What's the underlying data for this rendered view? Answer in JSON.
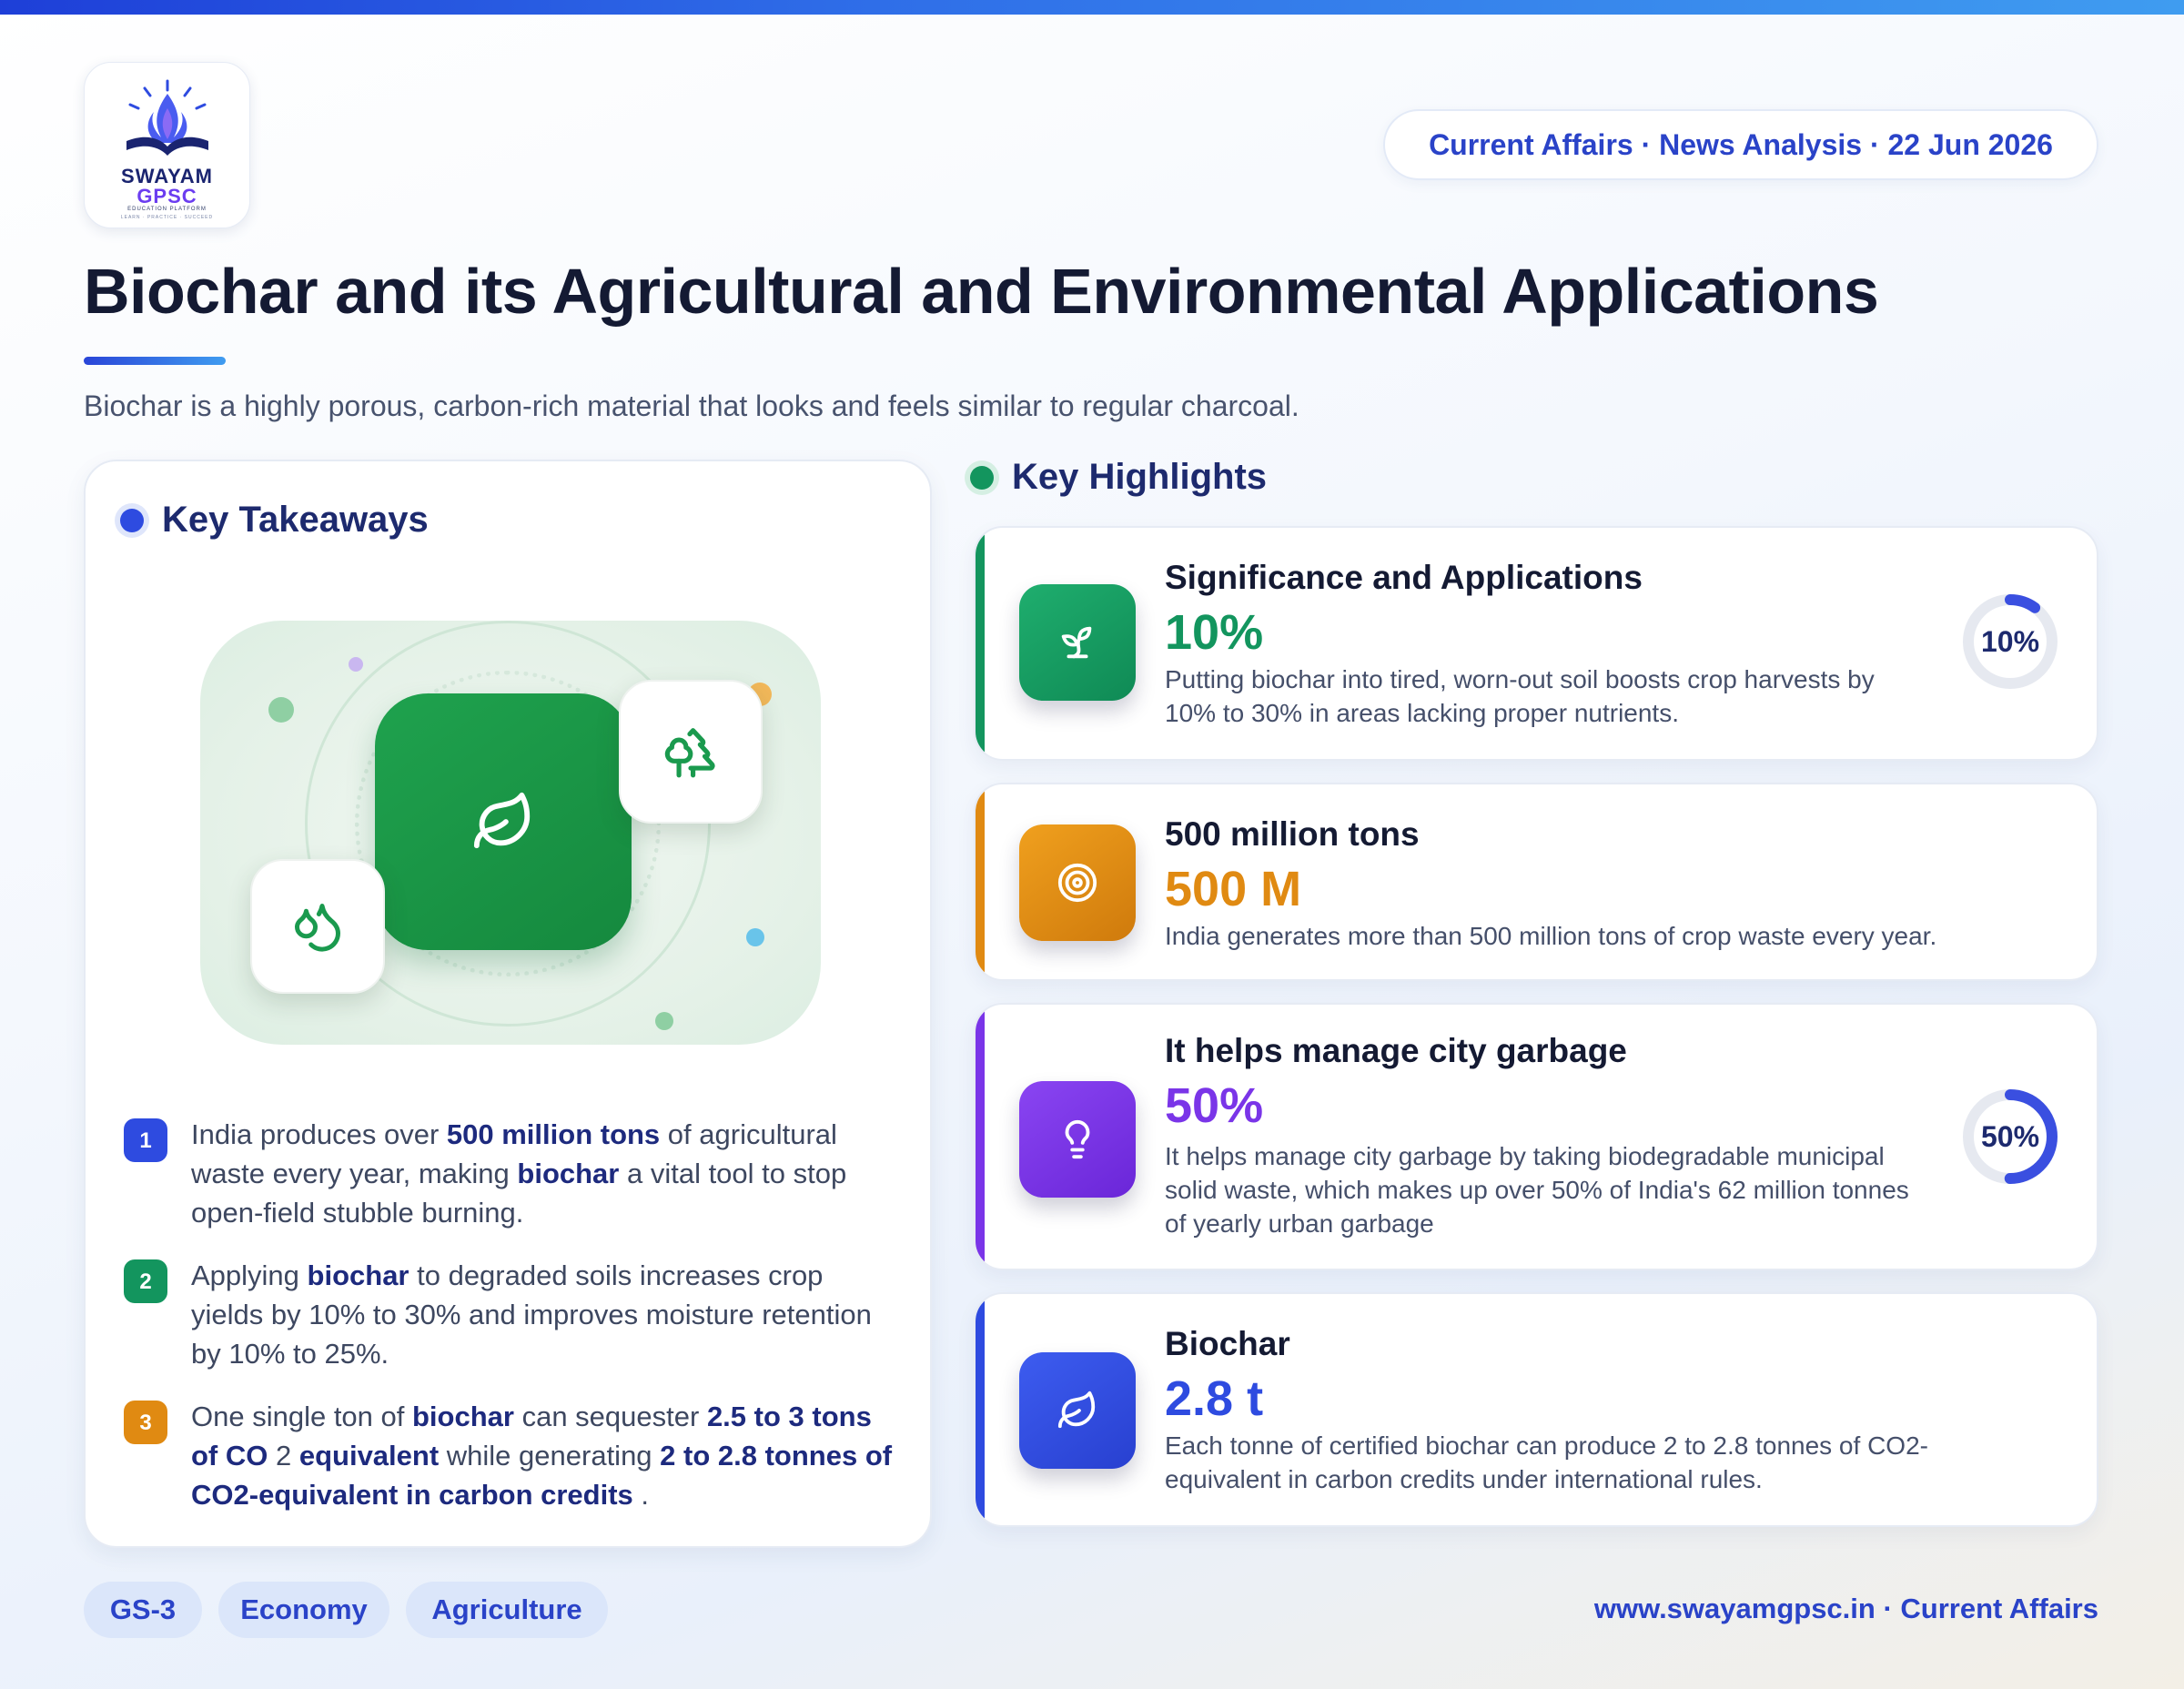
{
  "brand": {
    "line1": "SWAYAM",
    "line2": "GPSC",
    "tagline": "EDUCATION PLATFORM",
    "motto": "LEARN · PRACTICE · SUCCEED"
  },
  "header": {
    "date_pill": "Current Affairs · News Analysis · 22 Jun 2026",
    "title": "Biochar and its Agricultural and Environmental Applications",
    "subtitle": "Biochar is a highly porous, carbon-rich material that looks and feels similar to regular charcoal."
  },
  "takeaways": {
    "heading": "Key Takeaways",
    "illustration_icons": [
      "leaf-icon",
      "trees-icon",
      "droplets-icon"
    ],
    "items": [
      {
        "num": "1",
        "color": "#2e4be0",
        "parts": [
          "India produces over ",
          "500 million tons",
          " of agricultural waste every year, making ",
          "biochar",
          " a vital tool to stop open-field stubble burning."
        ]
      },
      {
        "num": "2",
        "color": "#13955e",
        "parts": [
          "Applying ",
          "biochar",
          " to degraded soils increases crop yields by 10% to 30% and improves moisture retention by 10% to 25%."
        ]
      },
      {
        "num": "3",
        "color": "#e08a12",
        "parts": [
          "One single ton of ",
          "biochar",
          " can sequester ",
          "2.5 to 3 tons of CO",
          " 2 ",
          "equivalent",
          " while generating ",
          "2 to 2.8 tonnes of CO2-equivalent in carbon credits",
          " ."
        ]
      }
    ]
  },
  "highlights": {
    "heading": "Key Highlights",
    "cards": [
      {
        "title": "Significance and Applications",
        "value": "10%",
        "desc": "Putting biochar into tired, worn-out soil boosts crop harvests by 10% to 30% in areas lacking proper nutrients.",
        "color": "#13955e",
        "icon": "sprout-icon",
        "gauge_label": "10%",
        "gauge_fraction": 0.1
      },
      {
        "title": "500 million tons",
        "value": "500 M",
        "desc": "India generates more than 500 million tons of crop waste every year.",
        "color": "#e08a12",
        "icon": "target-icon"
      },
      {
        "title": "It helps manage city garbage",
        "value": "50%",
        "desc": "It helps manage city garbage by taking biodegradable municipal solid waste, which makes up over 50% of India's 62 million tonnes of yearly urban garbage",
        "color": "#7a35e8",
        "icon": "lightbulb-icon",
        "gauge_label": "50%",
        "gauge_fraction": 0.5
      },
      {
        "title": "Biochar",
        "value": "2.8 t",
        "desc": "Each tonne of certified biochar can produce 2 to 2.8 tonnes of CO2-equivalent in carbon credits under international rules.",
        "color": "#2e4be0",
        "icon": "leaf-icon"
      }
    ]
  },
  "footer": {
    "tags": [
      "GS-3",
      "Economy",
      "Agriculture"
    ],
    "url": "www.swayamgpsc.in · Current Affairs"
  }
}
